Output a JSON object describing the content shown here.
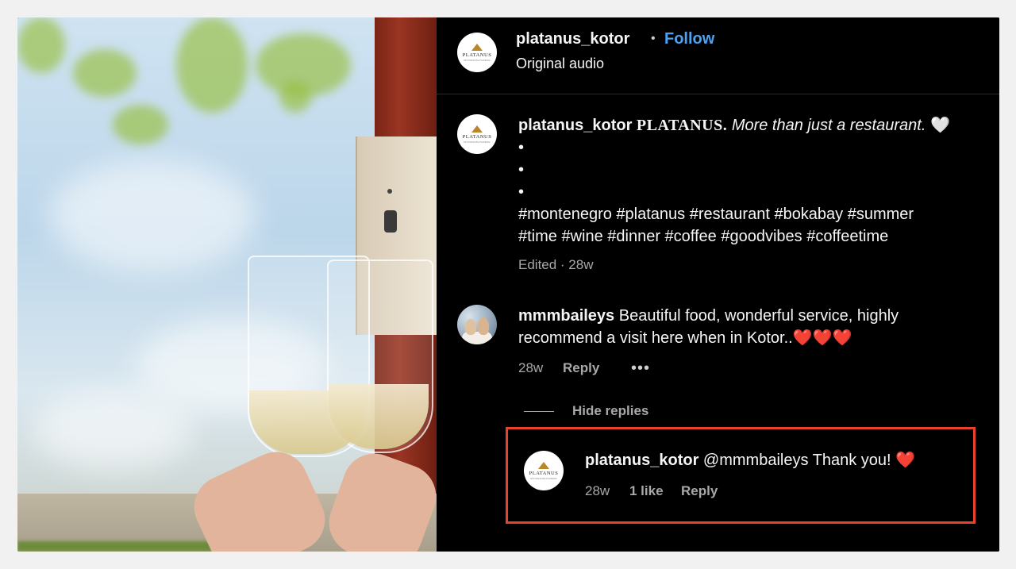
{
  "header": {
    "username": "platanus_kotor",
    "separator": "•",
    "follow_label": "Follow",
    "audio_label": "Original audio"
  },
  "logo": {
    "word": "PLATANUS",
    "subtitle": "RISTORANTE PIZZERIA"
  },
  "caption": {
    "username": "platanus_kotor",
    "brand": "PLATANUS.",
    "tagline": "More than  just a restaurant.",
    "heart": "🤍",
    "bullets": [
      "•",
      "•",
      "•"
    ],
    "hashtags_line1": "#montenegro #platanus #restaurant #bokabay #summer",
    "hashtags_line2": "#time #wine #dinner #coffee #goodvibes #coffeetime",
    "meta": "Edited · 28w"
  },
  "comment": {
    "username": "mmmbaileys",
    "text_line1": "Beautiful food, wonderful service, highly",
    "text_line2": "recommend a visit here when in Kotor..❤️❤️❤️",
    "time": "28w",
    "reply_label": "Reply",
    "more_label": "•••",
    "hide_replies_label": "Hide replies"
  },
  "reply": {
    "username": "platanus_kotor",
    "text": "@mmmbaileys Thank you! ❤️",
    "time": "28w",
    "likes": "1 like",
    "reply_label": "Reply"
  },
  "colors": {
    "follow": "#4aa3f5",
    "highlight": "#e8412e",
    "background": "#000000"
  }
}
